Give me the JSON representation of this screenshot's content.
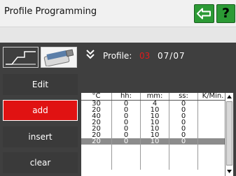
{
  "header": {
    "title": "Profile Programming",
    "help_label": "?"
  },
  "profile": {
    "label": "Profile:",
    "number": "03",
    "position": "07/07"
  },
  "actions": {
    "edit": "Edit",
    "add": "add",
    "insert": "insert",
    "clear": "clear"
  },
  "table": {
    "headers": [
      "°C",
      "hh:",
      "mm:",
      "ss:",
      "K/Min."
    ],
    "rows": [
      [
        "30",
        "0",
        "4",
        "0",
        ""
      ],
      [
        "20",
        "0",
        "10",
        "0",
        ""
      ],
      [
        "40",
        "0",
        "10",
        "0",
        ""
      ],
      [
        "20",
        "0",
        "10",
        "0",
        ""
      ],
      [
        "20",
        "0",
        "10",
        "0",
        ""
      ],
      [
        "20",
        "0",
        "10",
        "0",
        ""
      ],
      [
        "20",
        "0",
        "10",
        "0",
        ""
      ]
    ],
    "selected_row": 6
  },
  "colors": {
    "accent_green": "#2c9a35",
    "add_red": "#e01212",
    "panel": "#3f3f3f"
  },
  "icons": [
    "back-arrow-icon",
    "profile-graph-icon",
    "usb-stick-icon",
    "chevron-down-icon"
  ]
}
